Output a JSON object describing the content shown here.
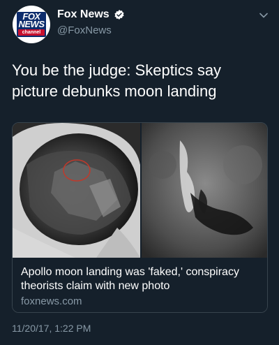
{
  "account": {
    "name": "Fox News",
    "handle": "@FoxNews",
    "logo_line1": "FOX",
    "logo_line2": "NEWS",
    "logo_line3": "channel",
    "verified": true,
    "avatar_icon": "fox-news-logo"
  },
  "tweet": {
    "text": "You be the judge: Skeptics say picture debunks moon landing",
    "timestamp": "11/20/17, 1:22 PM"
  },
  "card": {
    "image_description_icon": "moon-landing-photo",
    "title": "Apollo moon landing was 'faked,' conspiracy theorists claim with new photo",
    "domain": "foxnews.com"
  },
  "icons": {
    "menu": "chevron-down-icon",
    "verified": "verified-badge-icon"
  },
  "colors": {
    "background": "#15202b",
    "text_primary": "#ffffff",
    "text_secondary": "#8899a6",
    "border": "#38444d",
    "verified_badge": "#ffffff",
    "logo_blue": "#0d2c6c",
    "logo_red": "#c8102e"
  }
}
